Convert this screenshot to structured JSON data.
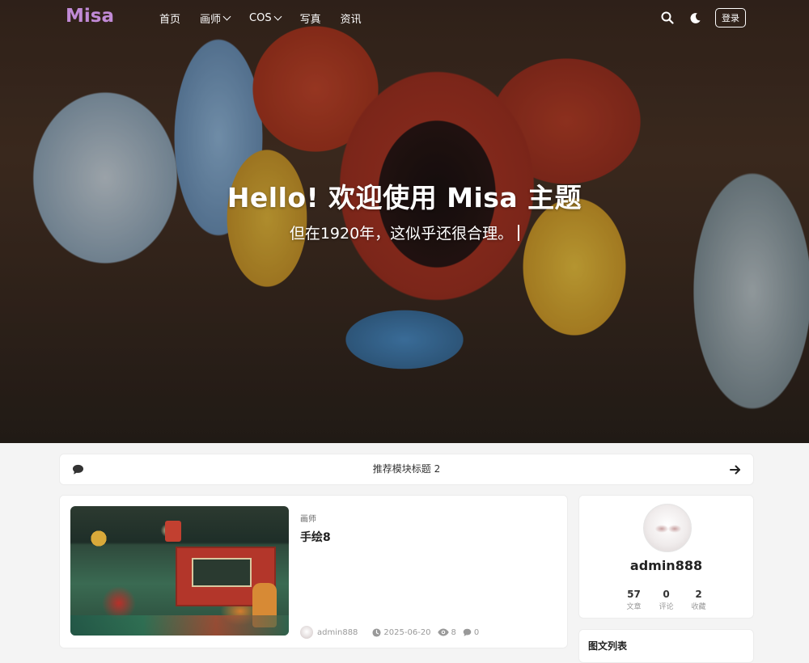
{
  "nav": {
    "logo": "Misa",
    "menu": [
      {
        "label": "首页",
        "has_dropdown": false
      },
      {
        "label": "画师",
        "has_dropdown": true
      },
      {
        "label": "COS",
        "has_dropdown": true
      },
      {
        "label": "写真",
        "has_dropdown": false
      },
      {
        "label": "资讯",
        "has_dropdown": false
      }
    ],
    "search_icon": "search-icon",
    "theme_icon": "moon-icon",
    "login_label": "登录"
  },
  "hero": {
    "title": "Hello! 欢迎使用 Misa 主题",
    "subtitle": "但在1920年，这似乎还很合理。"
  },
  "recommend": {
    "title": "推荐模块标题 2",
    "left_icon": "comment-icon",
    "right_icon": "arrow-right-icon"
  },
  "post": {
    "category": "画师",
    "title": "手绘8",
    "author": "admin888",
    "date": "2025-06-20",
    "views": "8",
    "comments": "0"
  },
  "profile": {
    "username": "admin888",
    "stats": [
      {
        "num": "57",
        "label": "文章"
      },
      {
        "num": "0",
        "label": "评论"
      },
      {
        "num": "2",
        "label": "收藏"
      }
    ]
  },
  "widget": {
    "title": "图文列表"
  },
  "colors": {
    "logo": "#c18ad6",
    "page_bg": "#f4f4f4"
  }
}
